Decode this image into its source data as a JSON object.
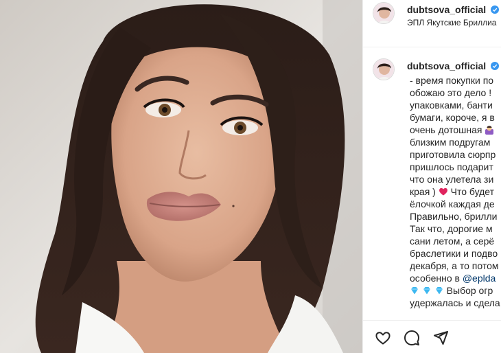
{
  "post": {
    "username": "dubtsova_official",
    "location": "ЭПЛ Якутские Бриллиа"
  },
  "caption": {
    "username": "dubtsova_official",
    "lines": [
      "- время покупки по",
      "обожаю это дело !",
      "упаковками, банти",
      "бумаги, короче, я в",
      "очень дотошная",
      "близким подругам",
      "приготовила сюрпр",
      "пришлось подарит",
      "что она улетела зи",
      "края )",
      "ёлочкой каждая де",
      "Правильно, брилли",
      "Так что, дорогие м",
      "сани летом, а серё",
      "браслетики и подво",
      "декабря, а то потом",
      "особенно в",
      "Выбор огр",
      "удержалась и сдела"
    ],
    "line_10_tail": "Что будет",
    "mention": "@eplda",
    "more_icon": "more-horizontal-icon"
  },
  "actions": {
    "like_icon": "heart-icon",
    "comment_icon": "comment-icon",
    "share_icon": "paper-plane-icon"
  },
  "colors": {
    "text": "#262626",
    "verified": "#3897f0",
    "mention": "#00376b",
    "border": "#efefef",
    "heart": "#e0245e",
    "diamond": "#3db8f0"
  }
}
